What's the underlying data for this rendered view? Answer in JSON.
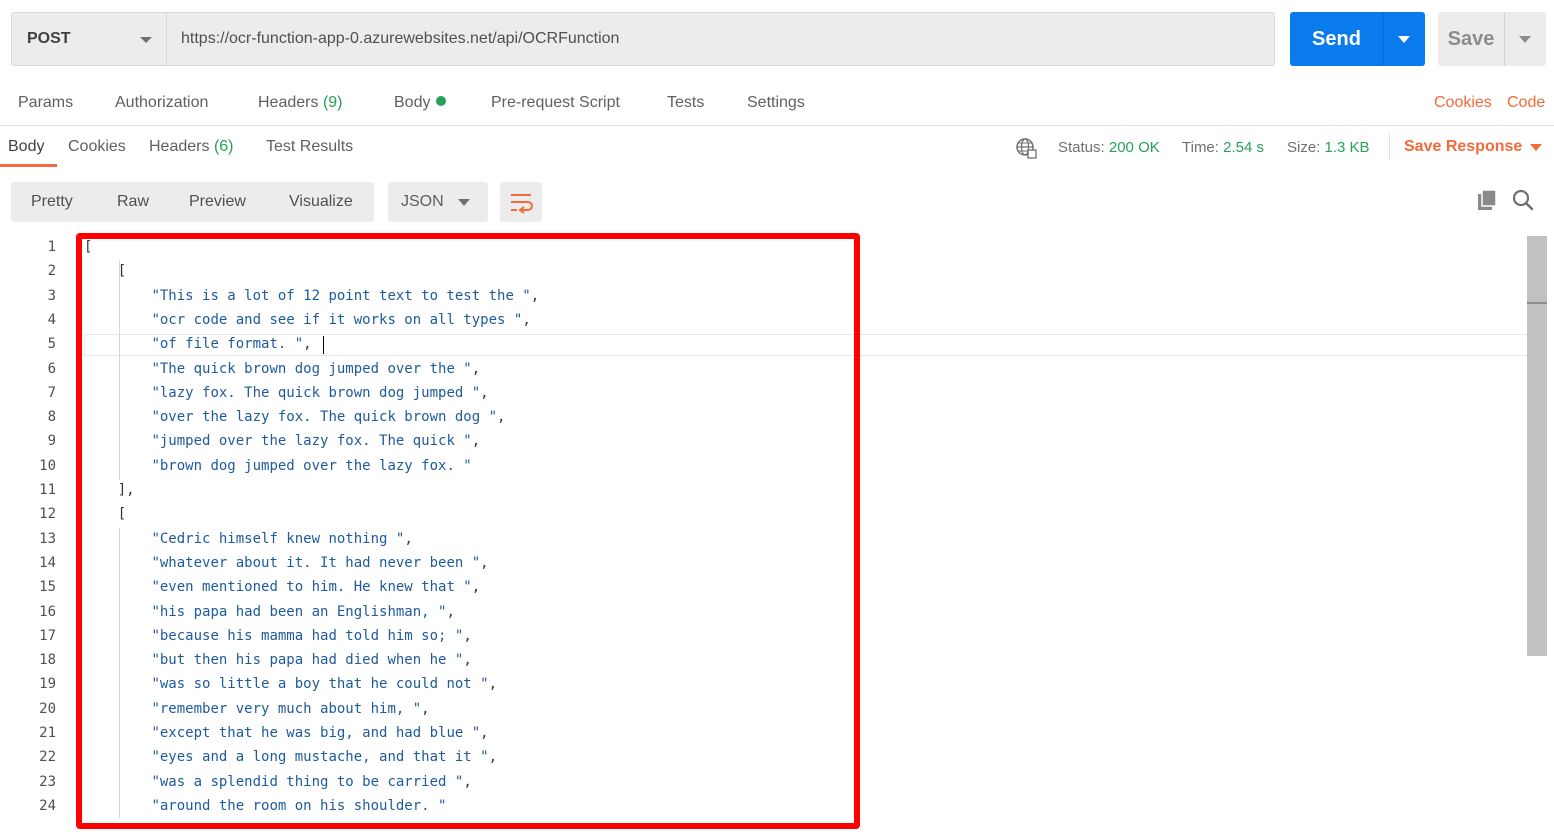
{
  "request": {
    "method": "POST",
    "url": "https://ocr-function-app-0.azurewebsites.net/api/OCRFunction",
    "send_label": "Send",
    "save_label": "Save"
  },
  "request_tabs": {
    "params": "Params",
    "authorization": "Authorization",
    "headers": "Headers",
    "headers_count": "(9)",
    "body": "Body",
    "pre_request": "Pre-request Script",
    "tests": "Tests",
    "settings": "Settings",
    "cookies_link": "Cookies",
    "code_link": "Code"
  },
  "response_tabs": {
    "body": "Body",
    "cookies": "Cookies",
    "headers": "Headers",
    "headers_count": "(6)",
    "test_results": "Test Results"
  },
  "response_meta": {
    "status_label": "Status:",
    "status_value": "200 OK",
    "time_label": "Time:",
    "time_value": "2.54 s",
    "size_label": "Size:",
    "size_value": "1.3 KB",
    "save_response": "Save Response"
  },
  "format_bar": {
    "pretty": "Pretty",
    "raw": "Raw",
    "preview": "Preview",
    "visualize": "Visualize",
    "language": "JSON"
  },
  "icons": {
    "globe": "globe-icon",
    "wrap": "wrap-lines-icon",
    "copy": "copy-icon",
    "search": "search-icon"
  },
  "colors": {
    "accent_orange": "#f26b3a",
    "send_blue": "#097bed",
    "status_green": "#26a05a",
    "highlight_red": "#ff0000",
    "string_blue": "#1e5a9c"
  },
  "editor": {
    "line_numbers": [
      "1",
      "2",
      "3",
      "4",
      "5",
      "6",
      "7",
      "8",
      "9",
      "10",
      "11",
      "12",
      "13",
      "14",
      "15",
      "16",
      "17",
      "18",
      "19",
      "20",
      "21",
      "22",
      "23",
      "24"
    ],
    "lines": [
      {
        "punct": "[",
        "str": "",
        "tail": ""
      },
      {
        "punct": "    [",
        "str": "",
        "tail": ""
      },
      {
        "punct": "        ",
        "str": "\"This is a lot of 12 point text to test the \"",
        "tail": ","
      },
      {
        "punct": "        ",
        "str": "\"ocr code and see if it works on all types \"",
        "tail": ","
      },
      {
        "punct": "        ",
        "str": "\"of file format. \"",
        "tail": ","
      },
      {
        "punct": "        ",
        "str": "\"The quick brown dog jumped over the \"",
        "tail": ","
      },
      {
        "punct": "        ",
        "str": "\"lazy fox. The quick brown dog jumped \"",
        "tail": ","
      },
      {
        "punct": "        ",
        "str": "\"over the lazy fox. The quick brown dog \"",
        "tail": ","
      },
      {
        "punct": "        ",
        "str": "\"jumped over the lazy fox. The quick \"",
        "tail": ","
      },
      {
        "punct": "        ",
        "str": "\"brown dog jumped over the lazy fox. \"",
        "tail": ""
      },
      {
        "punct": "    ],",
        "str": "",
        "tail": ""
      },
      {
        "punct": "    [",
        "str": "",
        "tail": ""
      },
      {
        "punct": "        ",
        "str": "\"Cedric himself knew nothing \"",
        "tail": ","
      },
      {
        "punct": "        ",
        "str": "\"whatever about it. It had never been \"",
        "tail": ","
      },
      {
        "punct": "        ",
        "str": "\"even mentioned to him. He knew that \"",
        "tail": ","
      },
      {
        "punct": "        ",
        "str": "\"his papa had been an Englishman, \"",
        "tail": ","
      },
      {
        "punct": "        ",
        "str": "\"because his mamma had told him so; \"",
        "tail": ","
      },
      {
        "punct": "        ",
        "str": "\"but then his papa had died when he \"",
        "tail": ","
      },
      {
        "punct": "        ",
        "str": "\"was so little a boy that he could not \"",
        "tail": ","
      },
      {
        "punct": "        ",
        "str": "\"remember very much about him, \"",
        "tail": ","
      },
      {
        "punct": "        ",
        "str": "\"except that he was big, and had blue \"",
        "tail": ","
      },
      {
        "punct": "        ",
        "str": "\"eyes and a long mustache, and that it \"",
        "tail": ","
      },
      {
        "punct": "        ",
        "str": "\"was a splendid thing to be carried \"",
        "tail": ","
      },
      {
        "punct": "        ",
        "str": "\"around the room on his shoulder. \"",
        "tail": ""
      }
    ]
  }
}
